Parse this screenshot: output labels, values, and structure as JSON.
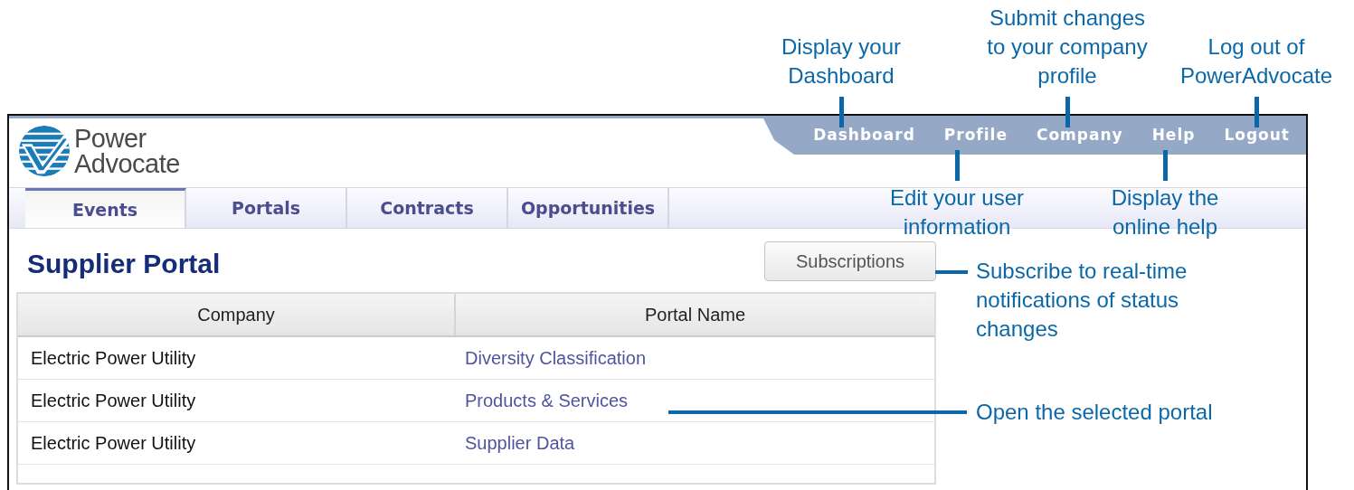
{
  "header": {
    "logo_text": [
      "Power",
      "Advocate"
    ],
    "nav": [
      {
        "label": "Dashboard"
      },
      {
        "label": "Profile"
      },
      {
        "label": "Company"
      },
      {
        "label": "Help"
      },
      {
        "label": "Logout"
      }
    ]
  },
  "tabs": [
    {
      "label": "Events",
      "selected": true
    },
    {
      "label": "Portals",
      "selected": false
    },
    {
      "label": "Contracts",
      "selected": false
    },
    {
      "label": "Opportunities",
      "selected": false
    }
  ],
  "page_title": "Supplier Portal",
  "subscriptions_button": "Subscriptions",
  "table": {
    "columns": [
      "Company",
      "Portal Name"
    ],
    "rows": [
      [
        "Electric Power Utility",
        "Diversity Classification"
      ],
      [
        "Electric Power Utility",
        "Products & Services"
      ],
      [
        "Electric Power Utility",
        "Supplier Data"
      ]
    ]
  },
  "callouts": [
    {
      "text": "Display your\nDashboard"
    },
    {
      "text": "Submit changes\nto your company\nprofile"
    },
    {
      "text": "Log out of\nPowerAdvocate"
    },
    {
      "text": "Edit your user\ninformation"
    },
    {
      "text": "Display the\nonline help"
    },
    {
      "text": "Subscribe to real-time\nnotifications of status\nchanges"
    },
    {
      "text": "Open the selected portal"
    }
  ]
}
